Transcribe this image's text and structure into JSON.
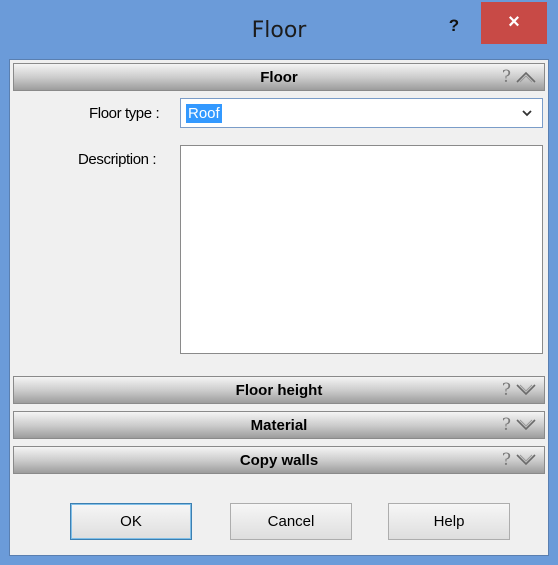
{
  "window": {
    "title": "Floor",
    "help_glyph": "?",
    "close_glyph": "×"
  },
  "sections": {
    "floor": {
      "title": "Floor",
      "expanded": true,
      "help_icon": "question-icon",
      "toggle_icon": "chevron-up-icon"
    },
    "floor_height": {
      "title": "Floor height",
      "expanded": false,
      "help_icon": "question-icon",
      "toggle_icon": "chevron-down-icon"
    },
    "material": {
      "title": "Material",
      "expanded": false,
      "help_icon": "question-icon",
      "toggle_icon": "chevron-down-icon"
    },
    "copy_walls": {
      "title": "Copy walls",
      "expanded": false,
      "help_icon": "question-icon",
      "toggle_icon": "chevron-down-icon"
    }
  },
  "floor_form": {
    "floor_type_label": "Floor type :",
    "floor_type_value": "Roof",
    "description_label": "Description :",
    "description_value": ""
  },
  "buttons": {
    "ok": "OK",
    "cancel": "Cancel",
    "help": "Help"
  },
  "glyphs": {
    "question": "?"
  },
  "colors": {
    "titlebar": "#6b9bd9",
    "close": "#c84a46",
    "selection": "#3399ff"
  }
}
